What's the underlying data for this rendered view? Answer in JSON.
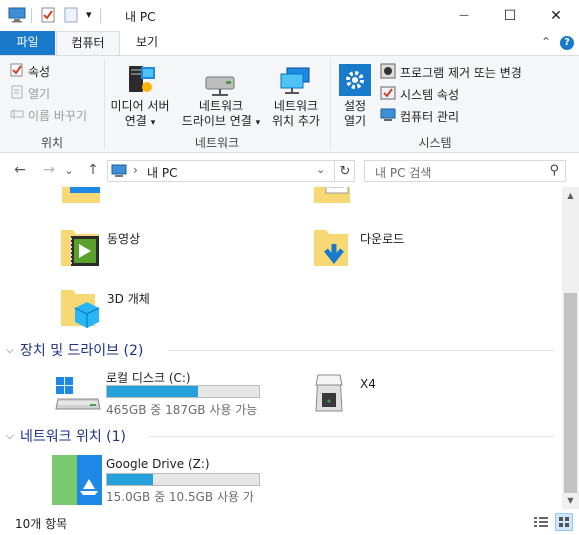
{
  "window": {
    "title": "내 PC"
  },
  "quick_access": {
    "dropdown_glyph": "▾"
  },
  "window_buttons": {
    "minimize": "—",
    "maximize": "☐",
    "close": "✕"
  },
  "tabs": {
    "file": "파일",
    "computer": "컴퓨터",
    "view": "보기",
    "collapse_glyph": "⌃",
    "help_glyph": "?"
  },
  "ribbon": {
    "location": {
      "properties": "속성",
      "open": "열기",
      "rename": "이름 바꾸기",
      "group": "위치"
    },
    "network": {
      "media_server_line1": "미디어 서버",
      "media_server_line2": "연결",
      "map_drive_line1": "네트워크",
      "map_drive_line2": "드라이브 연결",
      "add_location_line1": "네트워크",
      "add_location_line2": "위치 추가",
      "group": "네트워크",
      "dropdown_glyph": "▾"
    },
    "system": {
      "settings_line1": "설정",
      "settings_line2": "열기",
      "uninstall": "프로그램 제거 또는 변경",
      "system_properties": "시스템 속성",
      "manage": "컴퓨터 관리",
      "group": "시스템"
    }
  },
  "nav": {
    "back": "←",
    "forward": "→",
    "history": "⌄",
    "up": "↑",
    "breadcrumb_sep": "›",
    "path": "내 PC",
    "address_dropdown": "⌄",
    "refresh": "↻",
    "search_placeholder": "내 PC 검색",
    "search_icon": "⚲"
  },
  "folders": [
    {
      "name": "동영상"
    },
    {
      "name": "다운로드"
    },
    {
      "name": "3D 개체"
    }
  ],
  "sections": {
    "devices": {
      "title": "장치 및 드라이브 (2)",
      "chevron": "⌵"
    },
    "network": {
      "title": "네트워크 위치 (1)",
      "chevron": "⌵"
    }
  },
  "drives": [
    {
      "name": "로컬 디스크 (C:)",
      "free": "465GB 중 187GB 사용 가능",
      "used_fraction": 0.6
    },
    {
      "name": "X4"
    }
  ],
  "network_locations": [
    {
      "name": "Google Drive (Z:)",
      "free": "15.0GB 중 10.5GB 사용 가",
      "used_fraction": 0.3
    }
  ],
  "scrollbar": {
    "up": "▲",
    "down": "▼"
  },
  "status": {
    "count": "10개 항목"
  },
  "colors": {
    "accent": "#1979ca",
    "bar_fill": "#26a0da",
    "folder": "#f8d775",
    "section_title": "#1e3287"
  }
}
